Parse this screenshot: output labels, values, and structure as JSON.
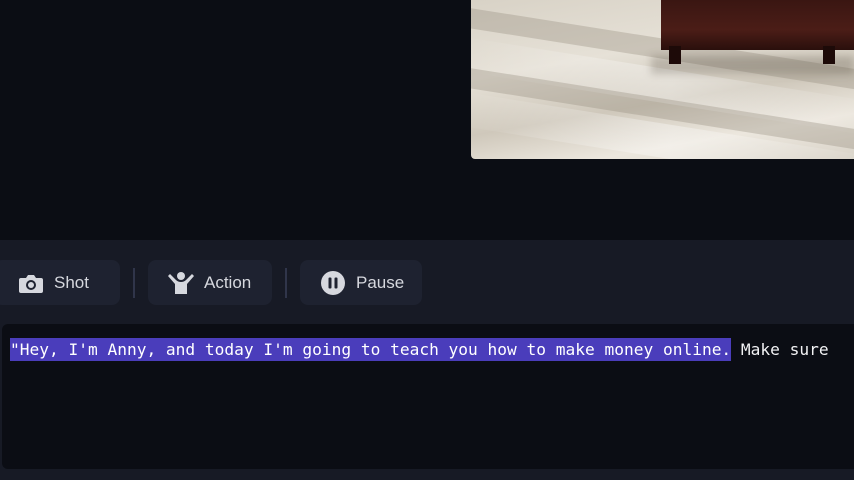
{
  "toolbar": {
    "buttons": [
      {
        "label": "Shot",
        "icon": "camera-icon"
      },
      {
        "label": "Action",
        "icon": "person-raise-hand-icon"
      },
      {
        "label": "Pause",
        "icon": "pause-icon"
      }
    ]
  },
  "editor": {
    "selected_text": "\"Hey, I'm Anny, and today I'm going to teach you how to make money online.",
    "rest_text": " Make sure"
  },
  "colors": {
    "background": "#0b0d14",
    "panel": "#171a25",
    "button": "#1e2230",
    "selection": "#4a3dbb"
  }
}
